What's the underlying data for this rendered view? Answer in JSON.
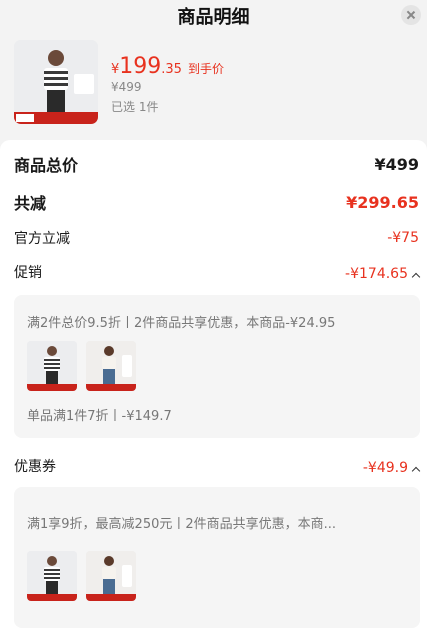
{
  "header": {
    "title": "商品明细"
  },
  "product": {
    "image_alt": "条纹短袖上衣模特图",
    "price_currency": "¥",
    "price_integer": "199",
    "price_decimal": ".35",
    "price_tag": "到手价",
    "original_price": "¥499",
    "selected_count": "已选 1件"
  },
  "summary": {
    "total_label": "商品总价",
    "total_value": "¥499",
    "discount_label": "共减",
    "discount_value": "¥299.65",
    "official_label": "官方立减",
    "official_value": "-¥75",
    "promo_label": "促销",
    "promo_value": "-¥174.65",
    "promo_details": {
      "line1": "满2件总价9.5折丨2件商品共享优惠，本商品-¥24.95",
      "line2": "单品满1件7折丨-¥149.7"
    },
    "coupon_label": "优惠券",
    "coupon_value": "-¥49.9",
    "coupon_details": {
      "line1": "满1享9折，最高减250元丨2件商品共享优惠，本商..."
    }
  },
  "colors": {
    "accent": "#e8321f",
    "muted": "#888888",
    "panel": "#f5f5f5"
  }
}
